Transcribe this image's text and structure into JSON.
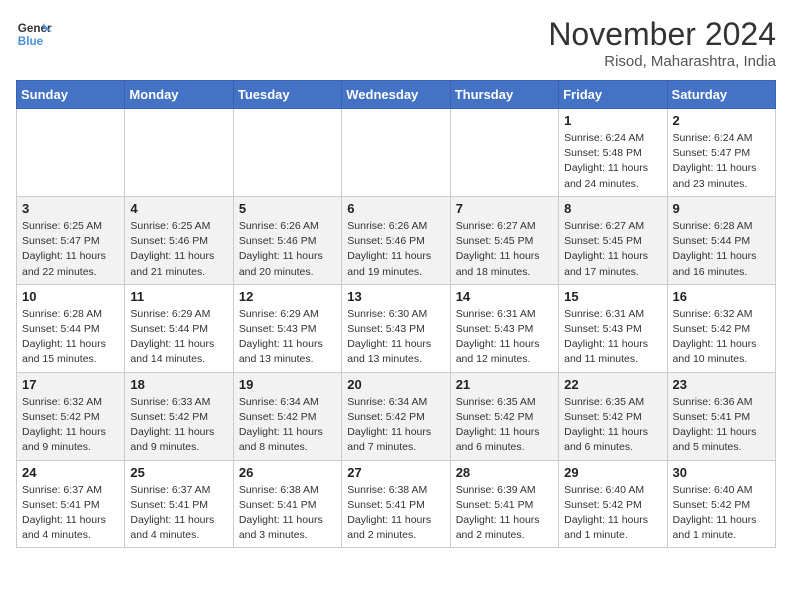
{
  "header": {
    "logo_line1": "General",
    "logo_line2": "Blue",
    "month": "November 2024",
    "location": "Risod, Maharashtra, India"
  },
  "weekdays": [
    "Sunday",
    "Monday",
    "Tuesday",
    "Wednesday",
    "Thursday",
    "Friday",
    "Saturday"
  ],
  "weeks": [
    [
      {
        "day": "",
        "info": ""
      },
      {
        "day": "",
        "info": ""
      },
      {
        "day": "",
        "info": ""
      },
      {
        "day": "",
        "info": ""
      },
      {
        "day": "",
        "info": ""
      },
      {
        "day": "1",
        "info": "Sunrise: 6:24 AM\nSunset: 5:48 PM\nDaylight: 11 hours and 24 minutes."
      },
      {
        "day": "2",
        "info": "Sunrise: 6:24 AM\nSunset: 5:47 PM\nDaylight: 11 hours and 23 minutes."
      }
    ],
    [
      {
        "day": "3",
        "info": "Sunrise: 6:25 AM\nSunset: 5:47 PM\nDaylight: 11 hours and 22 minutes."
      },
      {
        "day": "4",
        "info": "Sunrise: 6:25 AM\nSunset: 5:46 PM\nDaylight: 11 hours and 21 minutes."
      },
      {
        "day": "5",
        "info": "Sunrise: 6:26 AM\nSunset: 5:46 PM\nDaylight: 11 hours and 20 minutes."
      },
      {
        "day": "6",
        "info": "Sunrise: 6:26 AM\nSunset: 5:46 PM\nDaylight: 11 hours and 19 minutes."
      },
      {
        "day": "7",
        "info": "Sunrise: 6:27 AM\nSunset: 5:45 PM\nDaylight: 11 hours and 18 minutes."
      },
      {
        "day": "8",
        "info": "Sunrise: 6:27 AM\nSunset: 5:45 PM\nDaylight: 11 hours and 17 minutes."
      },
      {
        "day": "9",
        "info": "Sunrise: 6:28 AM\nSunset: 5:44 PM\nDaylight: 11 hours and 16 minutes."
      }
    ],
    [
      {
        "day": "10",
        "info": "Sunrise: 6:28 AM\nSunset: 5:44 PM\nDaylight: 11 hours and 15 minutes."
      },
      {
        "day": "11",
        "info": "Sunrise: 6:29 AM\nSunset: 5:44 PM\nDaylight: 11 hours and 14 minutes."
      },
      {
        "day": "12",
        "info": "Sunrise: 6:29 AM\nSunset: 5:43 PM\nDaylight: 11 hours and 13 minutes."
      },
      {
        "day": "13",
        "info": "Sunrise: 6:30 AM\nSunset: 5:43 PM\nDaylight: 11 hours and 13 minutes."
      },
      {
        "day": "14",
        "info": "Sunrise: 6:31 AM\nSunset: 5:43 PM\nDaylight: 11 hours and 12 minutes."
      },
      {
        "day": "15",
        "info": "Sunrise: 6:31 AM\nSunset: 5:43 PM\nDaylight: 11 hours and 11 minutes."
      },
      {
        "day": "16",
        "info": "Sunrise: 6:32 AM\nSunset: 5:42 PM\nDaylight: 11 hours and 10 minutes."
      }
    ],
    [
      {
        "day": "17",
        "info": "Sunrise: 6:32 AM\nSunset: 5:42 PM\nDaylight: 11 hours and 9 minutes."
      },
      {
        "day": "18",
        "info": "Sunrise: 6:33 AM\nSunset: 5:42 PM\nDaylight: 11 hours and 9 minutes."
      },
      {
        "day": "19",
        "info": "Sunrise: 6:34 AM\nSunset: 5:42 PM\nDaylight: 11 hours and 8 minutes."
      },
      {
        "day": "20",
        "info": "Sunrise: 6:34 AM\nSunset: 5:42 PM\nDaylight: 11 hours and 7 minutes."
      },
      {
        "day": "21",
        "info": "Sunrise: 6:35 AM\nSunset: 5:42 PM\nDaylight: 11 hours and 6 minutes."
      },
      {
        "day": "22",
        "info": "Sunrise: 6:35 AM\nSunset: 5:42 PM\nDaylight: 11 hours and 6 minutes."
      },
      {
        "day": "23",
        "info": "Sunrise: 6:36 AM\nSunset: 5:41 PM\nDaylight: 11 hours and 5 minutes."
      }
    ],
    [
      {
        "day": "24",
        "info": "Sunrise: 6:37 AM\nSunset: 5:41 PM\nDaylight: 11 hours and 4 minutes."
      },
      {
        "day": "25",
        "info": "Sunrise: 6:37 AM\nSunset: 5:41 PM\nDaylight: 11 hours and 4 minutes."
      },
      {
        "day": "26",
        "info": "Sunrise: 6:38 AM\nSunset: 5:41 PM\nDaylight: 11 hours and 3 minutes."
      },
      {
        "day": "27",
        "info": "Sunrise: 6:38 AM\nSunset: 5:41 PM\nDaylight: 11 hours and 2 minutes."
      },
      {
        "day": "28",
        "info": "Sunrise: 6:39 AM\nSunset: 5:41 PM\nDaylight: 11 hours and 2 minutes."
      },
      {
        "day": "29",
        "info": "Sunrise: 6:40 AM\nSunset: 5:42 PM\nDaylight: 11 hours and 1 minute."
      },
      {
        "day": "30",
        "info": "Sunrise: 6:40 AM\nSunset: 5:42 PM\nDaylight: 11 hours and 1 minute."
      }
    ]
  ]
}
